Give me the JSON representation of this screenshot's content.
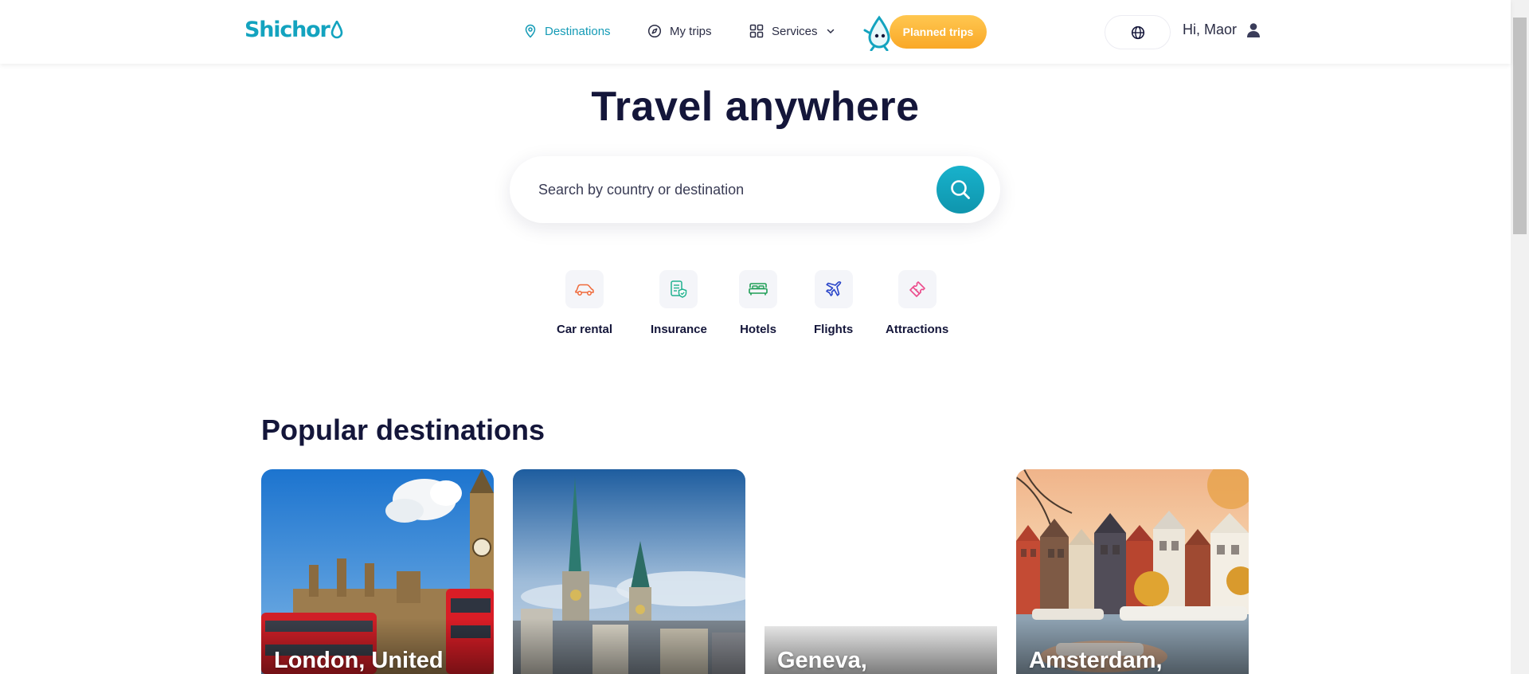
{
  "header": {
    "logo_text": "Shichor",
    "nav": {
      "destinations": "Destinations",
      "my_trips": "My trips",
      "services": "Services"
    },
    "planned_trips": "Planned trips",
    "greeting": "Hi, Maor"
  },
  "hero": {
    "title": "Travel anywhere",
    "search_placeholder": "Search by country or destination"
  },
  "categories": [
    {
      "label": "Car rental",
      "icon": "car-icon",
      "color": "#ef6a3a"
    },
    {
      "label": "Insurance",
      "icon": "insurance-document-icon",
      "color": "#21b28f"
    },
    {
      "label": "Hotels",
      "icon": "bed-icon",
      "color": "#1f9e57"
    },
    {
      "label": "Flights",
      "icon": "airplane-icon",
      "color": "#2a45c9"
    },
    {
      "label": "Attractions",
      "icon": "ticket-icon",
      "color": "#ec4c8c"
    }
  ],
  "popular": {
    "title": "Popular destinations",
    "cards": [
      {
        "name": "London, United"
      },
      {
        "name": ""
      },
      {
        "name": "Geneva,"
      },
      {
        "name": "Amsterdam,"
      }
    ]
  },
  "colors": {
    "brand": "#13a3bf",
    "accent_orange": "#f9a827",
    "heading": "#14163a"
  }
}
